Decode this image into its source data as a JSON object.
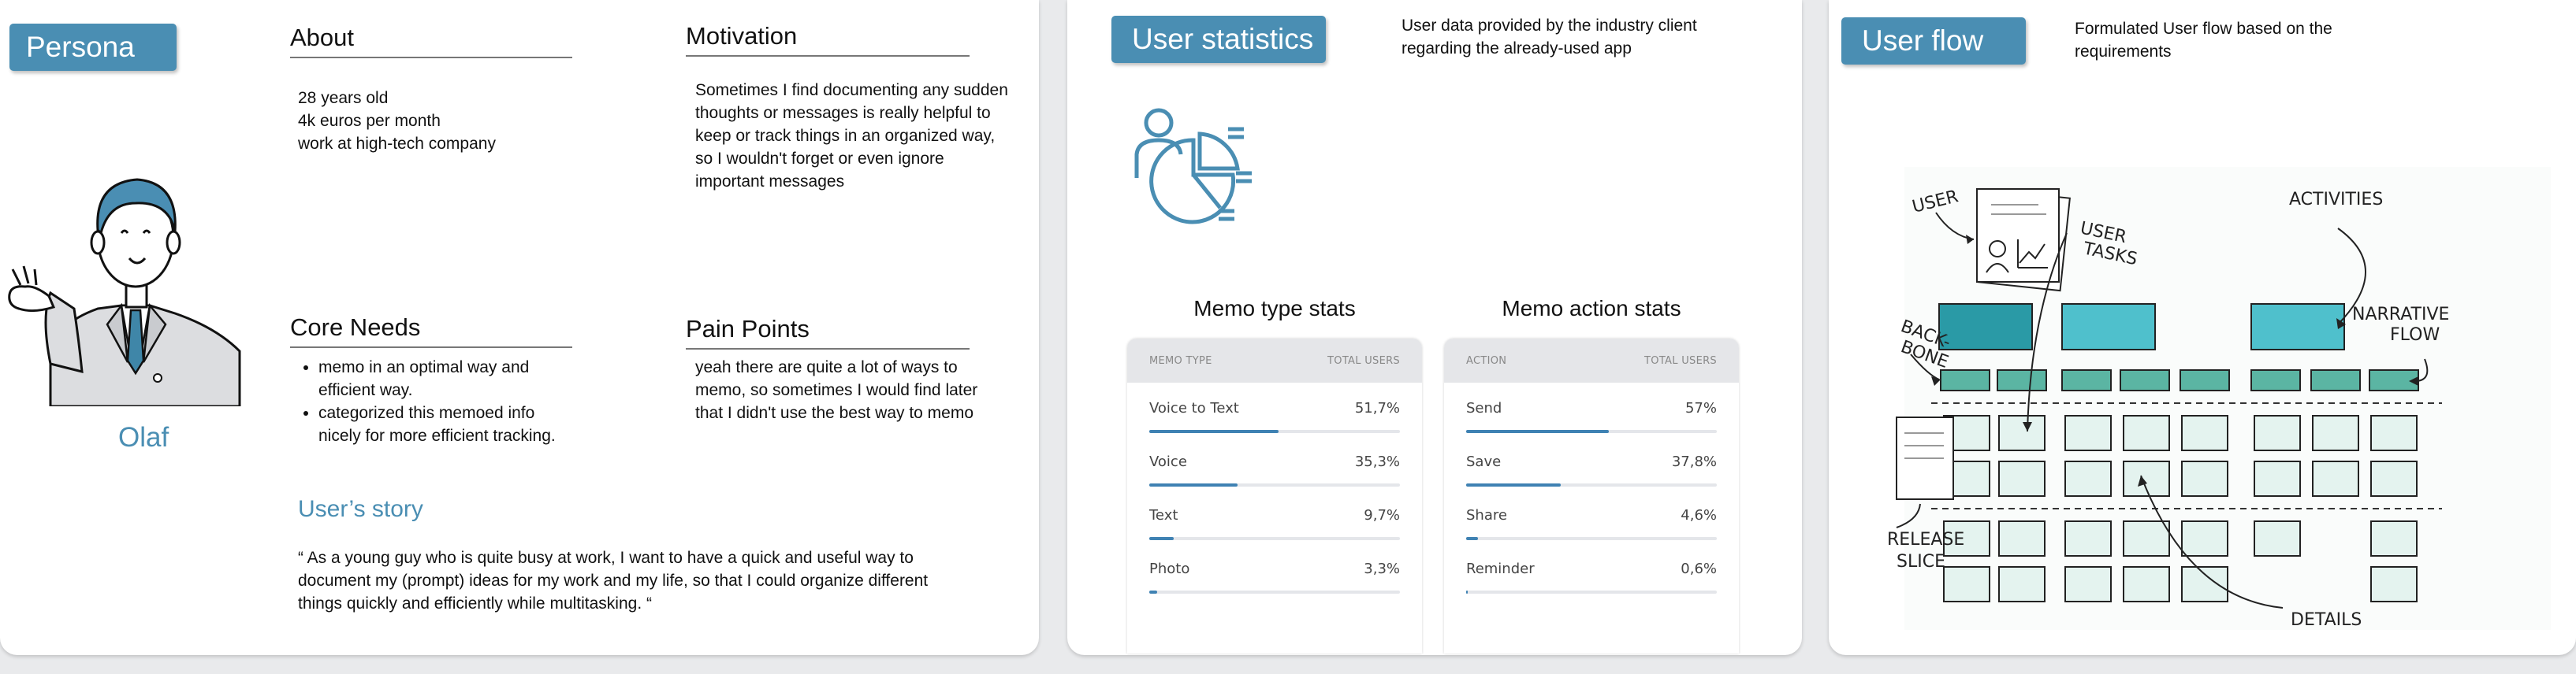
{
  "persona": {
    "tag": "Persona",
    "name": "Olaf",
    "about": {
      "title": "About",
      "lines": [
        "28 years old",
        "4k euros per month",
        "work at high-tech company"
      ]
    },
    "motivation": {
      "title": "Motivation",
      "text": "Sometimes I find documenting any sudden thoughts or messages is really helpful to keep or track things in an organized way, so I wouldn't forget or even ignore important messages"
    },
    "core_needs": {
      "title": "Core Needs",
      "items": [
        "memo in an optimal way and efficient way.",
        "categorized this memoed info nicely for more efficient tracking."
      ]
    },
    "pain_points": {
      "title": "Pain Points",
      "text": "yeah there are quite a lot of ways to memo, so sometimes I would find later that I didn't use the best way to memo"
    },
    "story": {
      "title": "User’s story",
      "text": "“ As a young guy who is quite busy at work, I want to have a quick and useful way to document my (prompt) ideas for my work and my life, so that I could organize different things quickly and efficiently while multitasking. “"
    }
  },
  "stats": {
    "tag": "User statistics",
    "note": "User data provided by the industry client regarding the already-used app",
    "memo_type": {
      "title": "Memo type stats",
      "col1": "MEMO TYPE",
      "col2": "TOTAL USERS",
      "rows": [
        {
          "label": "Voice to Text",
          "value": "51,7%",
          "pct": 51.7
        },
        {
          "label": "Voice",
          "value": "35,3%",
          "pct": 35.3
        },
        {
          "label": "Text",
          "value": "9,7%",
          "pct": 9.7
        },
        {
          "label": "Photo",
          "value": "3,3%",
          "pct": 3.3
        }
      ]
    },
    "memo_action": {
      "title": "Memo action stats",
      "col1": "ACTION",
      "col2": "TOTAL USERS",
      "rows": [
        {
          "label": "Send",
          "value": "57%",
          "pct": 57
        },
        {
          "label": "Save",
          "value": "37,8%",
          "pct": 37.8
        },
        {
          "label": "Share",
          "value": "4,6%",
          "pct": 4.6
        },
        {
          "label": "Reminder",
          "value": "0,6%",
          "pct": 0.6
        }
      ]
    }
  },
  "flow": {
    "tag": "User flow",
    "note": "Formulated User flow based on the requirements",
    "labels": {
      "user": "USER",
      "user_tasks_1": "USER",
      "user_tasks_2": "TASKS",
      "activities": "ACTIVITIES",
      "narrative_1": "NARRATIVE",
      "narrative_2": "FLOW",
      "backbone_1": "BACK-",
      "backbone_2": "BONE",
      "release_1": "RELEASE",
      "release_2": "SLICE",
      "details": "DETAILS"
    }
  },
  "colors": {
    "accent": "#4a8eb3",
    "teal_dark": "#2a9aa6",
    "teal_light": "#4fc0cc",
    "teal_mid": "#5bb5a3",
    "card": "#e4f3ef"
  }
}
